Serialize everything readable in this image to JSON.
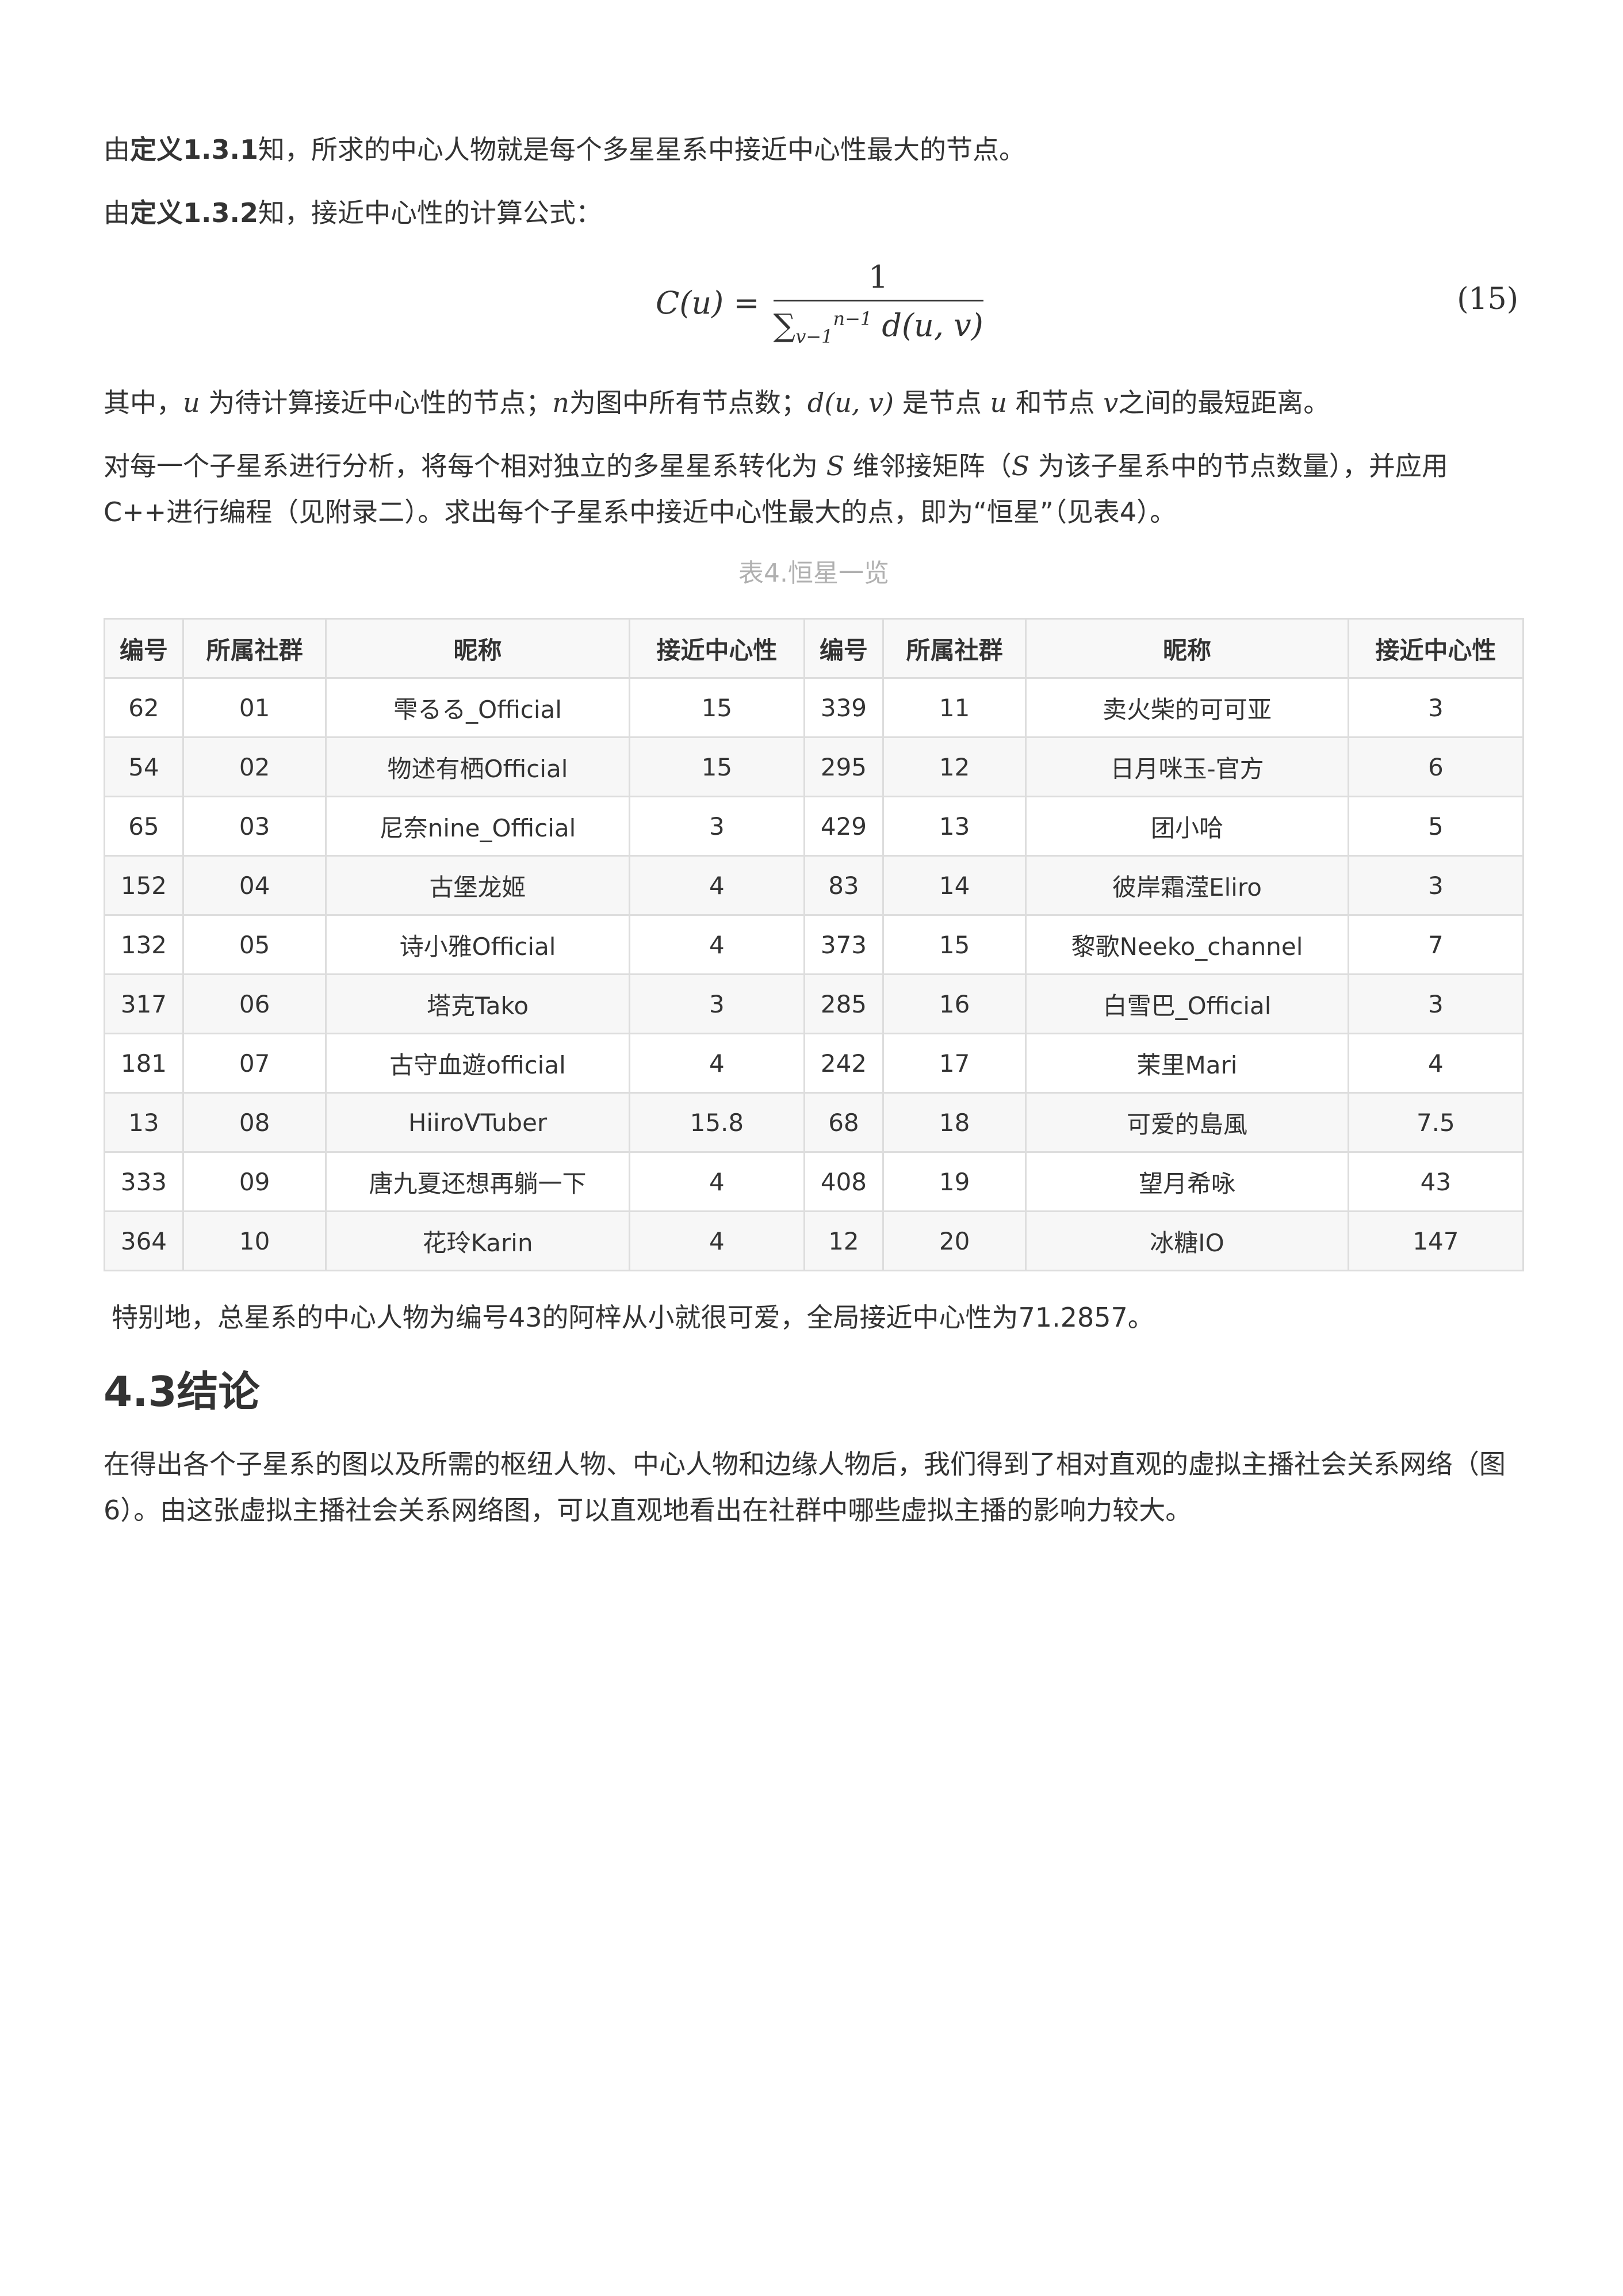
{
  "para1": {
    "prefix": "由",
    "bold": "定义1.3.1",
    "rest": "知，所求的中心人物就是每个多星星系中接近中心性最大的节点。"
  },
  "para2": {
    "prefix": "由",
    "bold": "定义1.3.2",
    "rest": "知，接近中心性的计算公式："
  },
  "equation": {
    "lhs": "C(u) =",
    "numerator": "1",
    "sum": "∑",
    "sub": "v−1",
    "sup": "n−1",
    "den_rest": "d(u, v)",
    "number": "(15)"
  },
  "para3": {
    "t1": "其中，",
    "m1": "u",
    "t2": " 为待计算接近中心性的节点；",
    "m2": "n",
    "t3": "为图中所有节点数；",
    "m3": "d(u, v)",
    "t4": " 是节点 ",
    "m4": "u",
    "t5": " 和节点 ",
    "m5": "v",
    "t6": "之间的最短距离。"
  },
  "para4": {
    "t1": "对每一个子星系进行分析，将每个相对独立的多星星系转化为 ",
    "m1": "S",
    "t2": " 维邻接矩阵（",
    "m2": "S",
    "t3": " 为该子星系中的节点数量），并应用C++进行编程（见附录二）。求出每个子星系中接近中心性最大的点，即为“恒星”（见表4）。"
  },
  "table": {
    "caption": "表4.恒星一览",
    "headers": [
      "编号",
      "所属社群",
      "昵称",
      "接近中心性",
      "编号",
      "所属社群",
      "昵称",
      "接近中心性"
    ],
    "rows": [
      [
        "62",
        "01",
        "雫るる_Official",
        "15",
        "339",
        "11",
        "卖火柴的可可亚",
        "3"
      ],
      [
        "54",
        "02",
        "物述有栖Official",
        "15",
        "295",
        "12",
        "日月咪玉-官方",
        "6"
      ],
      [
        "65",
        "03",
        "尼奈nine_Official",
        "3",
        "429",
        "13",
        "团小哈",
        "5"
      ],
      [
        "152",
        "04",
        "古堡龙姬",
        "4",
        "83",
        "14",
        "彼岸霜滢Eliro",
        "3"
      ],
      [
        "132",
        "05",
        "诗小雅Official",
        "4",
        "373",
        "15",
        "黎歌Neeko_channel",
        "7"
      ],
      [
        "317",
        "06",
        "塔克Tako",
        "3",
        "285",
        "16",
        "白雪巴_Official",
        "3"
      ],
      [
        "181",
        "07",
        "古守血遊official",
        "4",
        "242",
        "17",
        "茉里Mari",
        "4"
      ],
      [
        "13",
        "08",
        "HiiroVTuber",
        "15.8",
        "68",
        "18",
        "可爱的島風",
        "7.5"
      ],
      [
        "333",
        "09",
        "唐九夏还想再躺一下",
        "4",
        "408",
        "19",
        "望月希咏",
        "43"
      ],
      [
        "364",
        "10",
        "花玲Karin",
        "4",
        "12",
        "20",
        "冰糖IO",
        "147"
      ]
    ]
  },
  "note": "特别地，总星系的中心人物为编号43的阿梓从小就很可爱，全局接近中心性为71.2857。",
  "section_title": "4.3结论",
  "conclusion": "在得出各个子星系的图以及所需的枢纽人物、中心人物和边缘人物后，我们得到了相对直观的虚拟主播社会关系网络（图6）。由这张虚拟主播社会关系网络图，可以直观地看出在社群中哪些虚拟主播的影响力较大。"
}
